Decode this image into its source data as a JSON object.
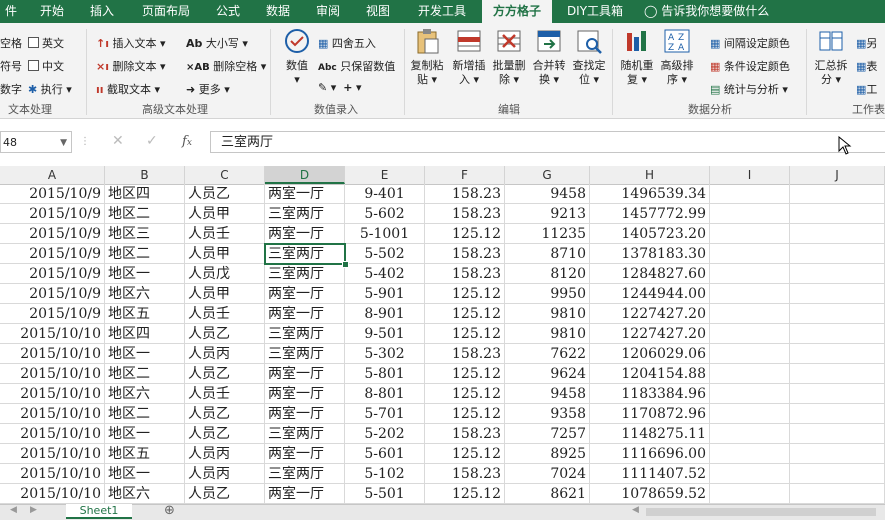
{
  "tabs": [
    "件",
    "开始",
    "插入",
    "页面布局",
    "公式",
    "数据",
    "审阅",
    "视图",
    "开发工具",
    "方方格子",
    "DIY工具箱",
    "告诉我你想要做什么"
  ],
  "active_tab": "方方格子",
  "ribbon": {
    "text_group": {
      "items": [
        "空格",
        "英文",
        "符号",
        "中文",
        "数字",
        "执行"
      ],
      "label": "文本处理"
    },
    "adv_text_group": {
      "insert_text": "插入文本",
      "delete_text": "删除文本",
      "cut_text": "截取文本",
      "case": "大小写",
      "delete_space": "删除空格",
      "more": "更多",
      "label": "高级文本处理"
    },
    "num_group": {
      "value": "数值",
      "round": "四舍五入",
      "keep_value": "只保留数值",
      "label": "数值录入"
    },
    "edit_group": {
      "copy_paste": [
        "复制粘",
        "贴"
      ],
      "add_insert": [
        "新增插",
        "入"
      ],
      "batch_delete": [
        "批量删",
        "除"
      ],
      "merge_convert": [
        "合并转",
        "换"
      ],
      "find_locate": [
        "查找定",
        "位"
      ],
      "label": "编辑"
    },
    "analysis_group": {
      "random_repeat": [
        "随机重",
        "复"
      ],
      "adv_sort": [
        "高级排",
        "序"
      ],
      "interval_color": "间隔设定颜色",
      "cond_color": "条件设定颜色",
      "stats": "统计与分析",
      "label": "数据分析"
    },
    "sheet_group": {
      "summary_split": [
        "汇总拆",
        "分"
      ],
      "side1": "另",
      "side2": "表",
      "side3": "工",
      "label": "工作表"
    }
  },
  "formula_bar": {
    "name_box": "48",
    "content": "三室两厅"
  },
  "columns": [
    "A",
    "B",
    "C",
    "D",
    "E",
    "F",
    "G",
    "H",
    "I",
    "J"
  ],
  "selected_column": "D",
  "rows": [
    [
      "2015/10/9",
      "地区四",
      "人员乙",
      "两室一厅",
      "9-401",
      "158.23",
      "9458",
      "1496539.34"
    ],
    [
      "2015/10/9",
      "地区二",
      "人员甲",
      "三室两厅",
      "5-602",
      "158.23",
      "9213",
      "1457772.99"
    ],
    [
      "2015/10/9",
      "地区三",
      "人员壬",
      "两室一厅",
      "5-1001",
      "125.12",
      "11235",
      "1405723.20"
    ],
    [
      "2015/10/9",
      "地区二",
      "人员甲",
      "三室两厅",
      "5-502",
      "158.23",
      "8710",
      "1378183.30"
    ],
    [
      "2015/10/9",
      "地区一",
      "人员戊",
      "三室两厅",
      "5-402",
      "158.23",
      "8120",
      "1284827.60"
    ],
    [
      "2015/10/9",
      "地区六",
      "人员甲",
      "两室一厅",
      "5-901",
      "125.12",
      "9950",
      "1244944.00"
    ],
    [
      "2015/10/9",
      "地区五",
      "人员壬",
      "两室一厅",
      "8-901",
      "125.12",
      "9810",
      "1227427.20"
    ],
    [
      "2015/10/10",
      "地区四",
      "人员乙",
      "三室两厅",
      "9-501",
      "125.12",
      "9810",
      "1227427.20"
    ],
    [
      "2015/10/10",
      "地区一",
      "人员丙",
      "三室两厅",
      "5-302",
      "158.23",
      "7622",
      "1206029.06"
    ],
    [
      "2015/10/10",
      "地区二",
      "人员乙",
      "两室一厅",
      "5-801",
      "125.12",
      "9624",
      "1204154.88"
    ],
    [
      "2015/10/10",
      "地区六",
      "人员壬",
      "两室一厅",
      "8-801",
      "125.12",
      "9458",
      "1183384.96"
    ],
    [
      "2015/10/10",
      "地区二",
      "人员乙",
      "两室一厅",
      "5-701",
      "125.12",
      "9358",
      "1170872.96"
    ],
    [
      "2015/10/10",
      "地区一",
      "人员乙",
      "三室两厅",
      "5-202",
      "158.23",
      "7257",
      "1148275.11"
    ],
    [
      "2015/10/10",
      "地区五",
      "人员丙",
      "两室一厅",
      "5-601",
      "125.12",
      "8925",
      "1116696.00"
    ],
    [
      "2015/10/10",
      "地区一",
      "人员丙",
      "三室两厅",
      "5-102",
      "158.23",
      "7024",
      "1111407.52"
    ],
    [
      "2015/10/10",
      "地区六",
      "人员乙",
      "两室一厅",
      "5-501",
      "125.12",
      "8621",
      "1078659.52"
    ]
  ],
  "sheet_tab": "Sheet1",
  "colors": {
    "accent": "#217346",
    "ribbon_bg": "#f3f3f3"
  }
}
